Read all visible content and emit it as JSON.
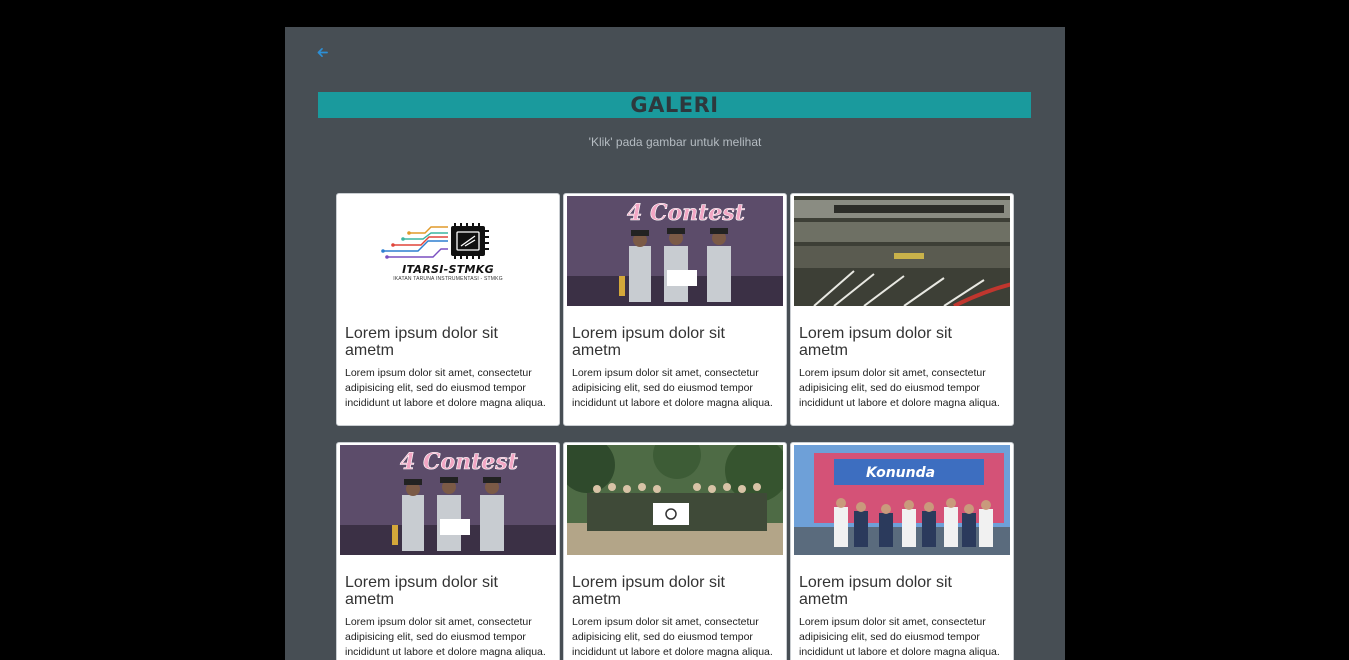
{
  "page": {
    "title": "GALERI",
    "subtitle": "'Klik' pada gambar untuk melihat",
    "back_icon": "arrow-left-icon"
  },
  "colors": {
    "background": "#000000",
    "panel": "#474e54",
    "title_bar": "#1a9a9d",
    "title_text": "#2e383d",
    "back_icon": "#2d8fd5"
  },
  "logo": {
    "name": "ITARSI-STMKG",
    "subtitle": "IKATAN TARUNA INSTRUMENTASI - STMKG"
  },
  "cards": [
    {
      "image": "itarsi-stmkg-logo",
      "title": "Lorem ipsum dolor sit ametm",
      "text": "Lorem ipsum dolor sit amet, consectetur adipisicing elit, sed do eiusmod tempor incididunt ut labore et dolore magna aliqua."
    },
    {
      "image": "contest-award-photo",
      "title": "Lorem ipsum dolor sit ametm",
      "text": "Lorem ipsum dolor sit amet, consectetur adipisicing elit, sed do eiusmod tempor incididunt ut labore et dolore magna aliqua."
    },
    {
      "image": "network-switch-photo",
      "title": "Lorem ipsum dolor sit ametm",
      "text": "Lorem ipsum dolor sit amet, consectetur adipisicing elit, sed do eiusmod tempor incididunt ut labore et dolore magna aliqua."
    },
    {
      "image": "contest-award-photo",
      "title": "Lorem ipsum dolor sit ametm",
      "text": "Lorem ipsum dolor sit amet, consectetur adipisicing elit, sed do eiusmod tempor incididunt ut labore et dolore magna aliqua."
    },
    {
      "image": "group-outdoor-photo",
      "title": "Lorem ipsum dolor sit ametm",
      "text": "Lorem ipsum dolor sit amet, consectetur adipisicing elit, sed do eiusmod tempor incididunt ut labore et dolore magna aliqua."
    },
    {
      "image": "group-banner-photo",
      "title": "Lorem ipsum dolor sit ametm",
      "text": "Lorem ipsum dolor sit amet, consectetur adipisicing elit, sed do eiusmod tempor incididunt ut labore et dolore magna aliqua."
    }
  ]
}
